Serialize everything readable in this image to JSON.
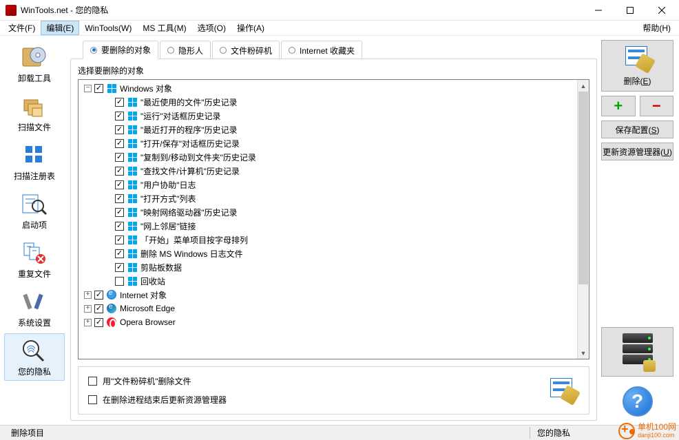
{
  "window": {
    "title": "WinTools.net - 您的隐私"
  },
  "menu": {
    "file": "文件(F)",
    "edit": "编辑(E)",
    "wintools": "WinTools(W)",
    "mstools": "MS 工具(M)",
    "options": "选项(O)",
    "actions": "操作(A)",
    "help": "帮助(H)"
  },
  "sidebar": {
    "items": [
      {
        "id": "uninstall",
        "label": "卸载工具"
      },
      {
        "id": "scanfiles",
        "label": "扫描文件"
      },
      {
        "id": "scanreg",
        "label": "扫描注册表"
      },
      {
        "id": "startup",
        "label": "启动项"
      },
      {
        "id": "dupfiles",
        "label": "重复文件"
      },
      {
        "id": "syssettings",
        "label": "系统设置"
      },
      {
        "id": "privacy",
        "label": "您的隐私"
      }
    ]
  },
  "tabs": {
    "t0": "要删除的对象",
    "t1": "隐形人",
    "t2": "文件粉碎机",
    "t3": "Internet 收藏夹"
  },
  "panel": {
    "caption": "选择要删除的对象"
  },
  "tree": {
    "root": "Windows 对象",
    "items": [
      "\"最近使用的文件\"历史记录",
      "\"运行\"对话框历史记录",
      "\"最近打开的程序\"历史记录",
      "\"打开/保存\"对话框历史记录",
      "\"复制到/移动到文件夹\"历史记录",
      "\"查找文件/计算机\"历史记录",
      "\"用户协助\"日志",
      "\"打开方式\"列表",
      "\"映射网络驱动器\"历史记录",
      "\"网上邻居\"链接",
      "「开始」菜单项目按字母排列",
      "删除 MS Windows 日志文件",
      "剪贴板数据",
      "回收站"
    ],
    "siblings": [
      "Internet 对象",
      "Microsoft Edge",
      "Opera Browser"
    ]
  },
  "bottom": {
    "opt1": "用\"文件粉碎机\"删除文件",
    "opt2": "在删除进程结束后更新资源管理器"
  },
  "right": {
    "delete": "删除(E)",
    "saveconfig": "保存配置(S)",
    "refreshexplorer": "更新资源管理器(U)"
  },
  "status": {
    "left": "删除项目",
    "right": "您的隐私"
  },
  "watermark": {
    "line1": "单机100网",
    "line2": "danji100.com"
  }
}
